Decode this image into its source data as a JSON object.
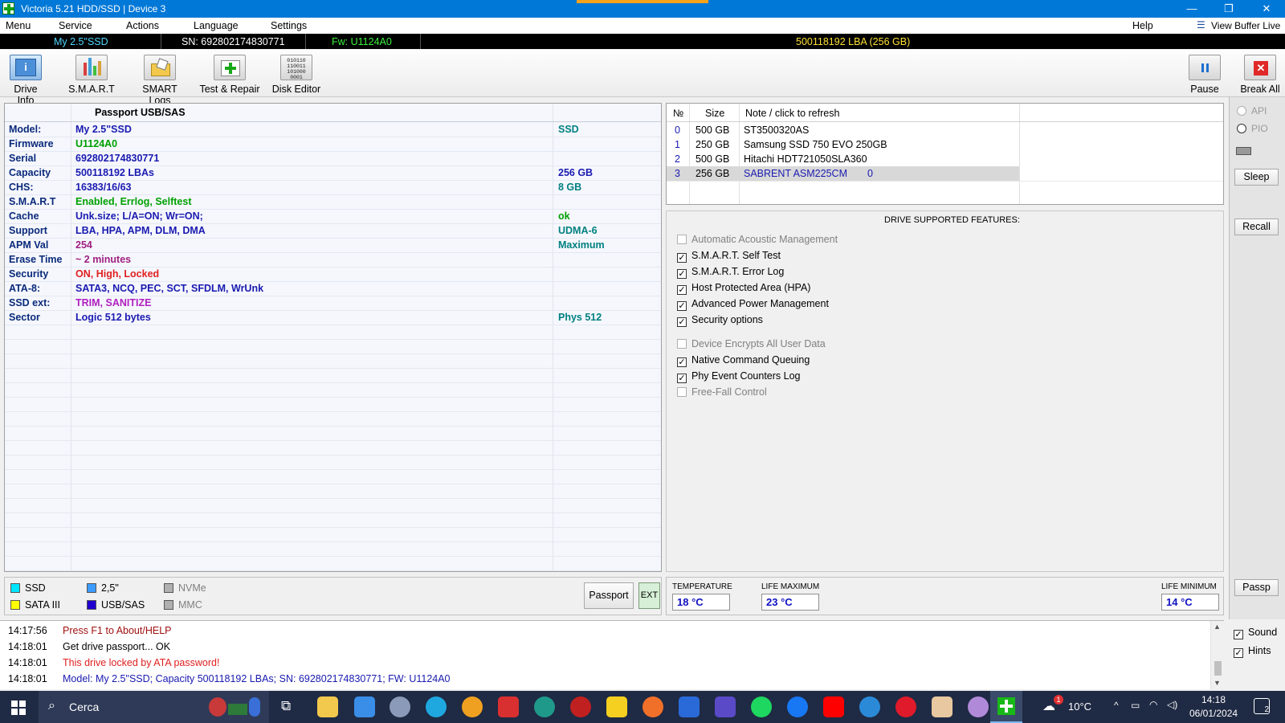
{
  "window": {
    "title": "Victoria 5.21 HDD/SSD | Device 3",
    "minimize": "—",
    "restore": "❐",
    "close": "✕"
  },
  "menu": {
    "items": [
      "Menu",
      "Service",
      "Actions",
      "Language",
      "Settings"
    ],
    "help": "Help",
    "view_buffer": "View Buffer Live"
  },
  "infobar": {
    "model": "My 2.5\"SSD",
    "serial": "SN: 692802174830771",
    "firmware": "Fw: U1124A0",
    "lba": "500118192 LBA (256 GB)"
  },
  "toolbar": {
    "drive_info": "Drive Info",
    "smart": "S.M.A.R.T",
    "smart_logs": "SMART Logs",
    "test_repair": "Test & Repair",
    "disk_editor": "Disk Editor",
    "pause": "Pause",
    "break_all": "Break All",
    "disk_editor_bits": "010110 110011 101000 0001"
  },
  "passport": {
    "header": "Passport USB/SAS",
    "rows": [
      {
        "label": "Model:",
        "value": "My 2.5\"SSD",
        "extra": "SSD",
        "color": "#1a1ab0",
        "extra_color": "#008080"
      },
      {
        "label": "Firmware",
        "value": "U1124A0",
        "extra": "",
        "color": "#00a000",
        "extra_color": "#008080"
      },
      {
        "label": "Serial",
        "value": "692802174830771",
        "extra": "",
        "color": "#1a1ab0",
        "extra_color": "#008080"
      },
      {
        "label": "Capacity",
        "value": "500118192 LBAs",
        "extra": "256 GB",
        "color": "#1a1ab0",
        "extra_color": "#1a1ab0"
      },
      {
        "label": "CHS:",
        "value": "16383/16/63",
        "extra": "8 GB",
        "color": "#1a1ab0",
        "extra_color": "#008080"
      },
      {
        "label": "S.M.A.R.T",
        "value": "Enabled, Errlog, Selftest",
        "extra": "",
        "color": "#00a000",
        "extra_color": "#008080"
      },
      {
        "label": "Cache",
        "value": "Unk.size; L/A=ON; Wr=ON;",
        "extra": "ok",
        "color": "#1a1ab0",
        "extra_color": "#00a000"
      },
      {
        "label": "Support",
        "value": "LBA, HPA, APM, DLM, DMA",
        "extra": "UDMA-6",
        "color": "#1a1ab0",
        "extra_color": "#008080"
      },
      {
        "label": "APM Val",
        "value": "254",
        "extra": "Maximum",
        "color": "#a02080",
        "extra_color": "#008080"
      },
      {
        "label": "Erase Time",
        "value": "~ 2 minutes",
        "extra": "",
        "color": "#a02080",
        "extra_color": "#008080"
      },
      {
        "label": "Security",
        "value": "ON, High, Locked",
        "extra": "",
        "color": "#e02020",
        "extra_color": "#008080"
      },
      {
        "label": "ATA-8:",
        "value": "SATA3, NCQ, PEC, SCT, SFDLM, WrUnk",
        "extra": "",
        "color": "#1a1ab0",
        "extra_color": "#008080"
      },
      {
        "label": "SSD ext:",
        "value": "TRIM, SANITIZE",
        "extra": "",
        "color": "#b020c0",
        "extra_color": "#008080"
      },
      {
        "label": "Sector",
        "value": "Logic 512 bytes",
        "extra": "Phys 512",
        "color": "#1a1ab0",
        "extra_color": "#008080"
      }
    ]
  },
  "drives": {
    "headers": {
      "num": "№",
      "size": "Size",
      "note": "Note / click to refresh"
    },
    "rows": [
      {
        "num": "0",
        "size": "500 GB",
        "note": "ST3500320AS",
        "extra": ""
      },
      {
        "num": "1",
        "size": "250 GB",
        "note": "Samsung SSD 750 EVO 250GB",
        "extra": ""
      },
      {
        "num": "2",
        "size": "500 GB",
        "note": "Hitachi HDT721050SLA360",
        "extra": ""
      },
      {
        "num": "3",
        "size": "256 GB",
        "note": "SABRENT ASM225CM",
        "extra": "0",
        "selected": true
      }
    ]
  },
  "features": {
    "title": "DRIVE SUPPORTED FEATURES:",
    "items": [
      {
        "label": "Automatic Acoustic Management",
        "checked": false,
        "enabled": false
      },
      {
        "label": "S.M.A.R.T. Self Test",
        "checked": true,
        "enabled": true
      },
      {
        "label": "S.M.A.R.T. Error Log",
        "checked": true,
        "enabled": true
      },
      {
        "label": "Host Protected Area (HPA)",
        "checked": true,
        "enabled": true
      },
      {
        "label": "Advanced Power Management",
        "checked": true,
        "enabled": true
      },
      {
        "label": "Security options",
        "checked": true,
        "enabled": true
      },
      {
        "label": "Device Encrypts All User Data",
        "checked": false,
        "enabled": false
      },
      {
        "label": "Native Command Queuing",
        "checked": true,
        "enabled": true
      },
      {
        "label": "Phy Event Counters Log",
        "checked": true,
        "enabled": true
      },
      {
        "label": "Free-Fall Control",
        "checked": false,
        "enabled": false
      }
    ]
  },
  "sidebar": {
    "api": "API",
    "pio": "PIO",
    "sleep": "Sleep",
    "recall": "Recall",
    "passp": "Passp",
    "sound": "Sound",
    "hints": "Hints"
  },
  "legend": {
    "ssd": "SSD",
    "sata": "SATA III",
    "size25": "2,5\"",
    "usbsas": "USB/SAS",
    "nvme": "NVMe",
    "mmc": "MMC",
    "passport_btn": "Passport",
    "ext_btn": "EXT",
    "colors": {
      "ssd": "#00e5ff",
      "sata": "#ffff00",
      "size25": "#3c9cff",
      "usbsas": "#2000d0",
      "nvme": "#b0b0b0",
      "mmc": "#b0b0b0"
    }
  },
  "temps": {
    "temperature_label": "TEMPERATURE",
    "temperature": "18 °C",
    "lifemax_label": "LIFE MAXIMUM",
    "lifemax": "23 °C",
    "lifemin_label": "LIFE MINIMUM",
    "lifemin": "14 °C"
  },
  "log": [
    {
      "time": "14:17:56",
      "msg": "Press F1 to About/HELP",
      "color": "#a01010"
    },
    {
      "time": "14:18:01",
      "msg": "Get drive passport... OK",
      "color": "#000000"
    },
    {
      "time": "14:18:01",
      "msg": "This drive locked by ATA password!",
      "color": "#e02020"
    },
    {
      "time": "14:18:01",
      "msg": "Model: My 2.5\"SSD; Capacity 500118192 LBAs; SN: 692802174830771; FW: U1124A0",
      "color": "#1a1ab0"
    }
  ],
  "taskbar": {
    "search": "Cerca",
    "weather": "10°C",
    "time": "14:18",
    "date": "06/01/2024",
    "notif_count": "2",
    "weather_badge": "1"
  }
}
